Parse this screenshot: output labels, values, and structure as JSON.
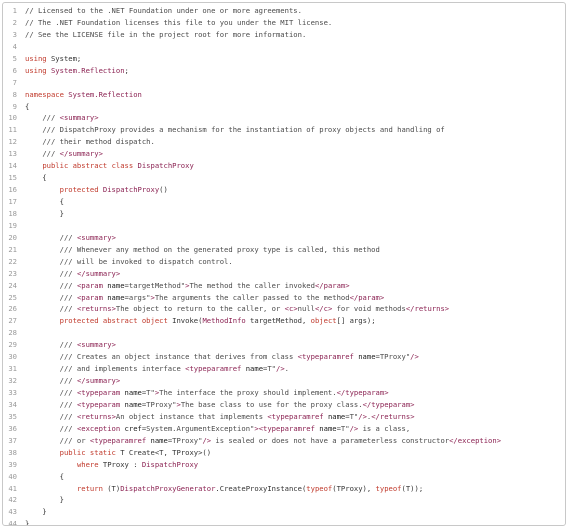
{
  "file": {
    "lines": [
      "// Licensed to the .NET Foundation under one or more agreements.",
      "// The .NET Foundation licenses this file to you under the MIT license.",
      "// See the LICENSE file in the project root for more information.",
      "",
      "using System;",
      "using System.Reflection;",
      "",
      "namespace System.Reflection",
      "{",
      "    /// <summary>",
      "    /// DispatchProxy provides a mechanism for the instantiation of proxy objects and handling of",
      "    /// their method dispatch.",
      "    /// </summary>",
      "    public abstract class DispatchProxy",
      "    {",
      "        protected DispatchProxy()",
      "        {",
      "        }",
      "",
      "        /// <summary>",
      "        /// Whenever any method on the generated proxy type is called, this method",
      "        /// will be invoked to dispatch control.",
      "        /// </summary>",
      "        /// <param name=\"targetMethod\">The method the caller invoked</param>",
      "        /// <param name=\"args\">The arguments the caller passed to the method</param>",
      "        /// <returns>The object to return to the caller, or <c>null</c> for void methods</returns>",
      "        protected abstract object Invoke(MethodInfo targetMethod, object[] args);",
      "",
      "        /// <summary>",
      "        /// Creates an object instance that derives from class <typeparamref name=\"TProxy\"/>",
      "        /// and implements interface <typeparamref name=\"T\"/>.",
      "        /// </summary>",
      "        /// <typeparam name=\"T\">The interface the proxy should implement.</typeparam>",
      "        /// <typeparam name=\"TProxy\">The base class to use for the proxy class.</typeparam>",
      "        /// <returns>An object instance that implements <typeparamref name=\"T\"/>.</returns>",
      "        /// <exception cref=\"System.ArgumentException\"><typeparamref name=\"T\"/> is a class,",
      "        /// or <typeparamref name=\"TProxy\"/> is sealed or does not have a parameterless constructor</exception>",
      "        public static T Create<T, TProxy>()",
      "            where TProxy : DispatchProxy",
      "        {",
      "            return (T)DispatchProxyGenerator.CreateProxyInstance(typeof(TProxy), typeof(T));",
      "        }",
      "    }",
      "}"
    ]
  },
  "colors": {
    "background": "#ffffff",
    "line_number": "#9a9a9a",
    "comment": "#4a4a4a",
    "xml_tag": "#8b2252",
    "keyword": "#c0392b"
  }
}
